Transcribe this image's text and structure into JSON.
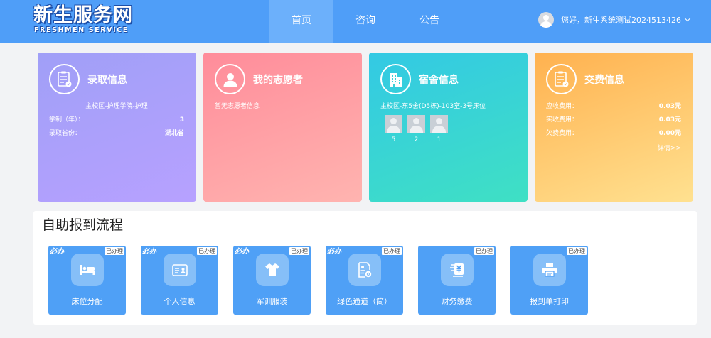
{
  "header": {
    "logo_main": "新生服务网",
    "logo_sub": "FRESHMEN SERVICE",
    "nav": [
      "首页",
      "咨询",
      "公告"
    ],
    "user_greeting": "您好，新生系统测试2024513426"
  },
  "cards": {
    "admission": {
      "title": "录取信息",
      "major": "主校区-护理学院-护理",
      "rows": [
        {
          "label": "学制（年）：",
          "value": "3"
        },
        {
          "label": "录取省份：",
          "value": "湖北省"
        }
      ]
    },
    "volunteer": {
      "title": "我的志愿者",
      "empty_text": "暂无志愿者信息"
    },
    "dorm": {
      "title": "宿舍信息",
      "location": "主校区-东5舍(D5栋)-103室-3号床位",
      "beds": [
        "5",
        "2",
        "1"
      ]
    },
    "fees": {
      "title": "交费信息",
      "rows": [
        {
          "label": "应收费用：",
          "value": "0.03元"
        },
        {
          "label": "实收费用：",
          "value": "0.03元"
        },
        {
          "label": "欠费费用：",
          "value": "0.00元"
        }
      ],
      "detail_link": "详情>>"
    }
  },
  "process": {
    "title": "自助报到流程",
    "required_tag": "必办",
    "done_tag": "已办理",
    "steps": [
      {
        "label": "床位分配",
        "icon": "bed-icon"
      },
      {
        "label": "个人信息",
        "icon": "id-card-icon"
      },
      {
        "label": "军训服装",
        "icon": "tshirt-icon"
      },
      {
        "label": "绿色通道（简）",
        "icon": "document-gear-icon"
      },
      {
        "label": "财务缴费",
        "icon": "yuan-payment-icon"
      },
      {
        "label": "报到单打印",
        "icon": "printer-icon"
      }
    ]
  },
  "colors": {
    "header_bg": "#4f9ef8",
    "tile_bg": "#4fa0f6"
  }
}
